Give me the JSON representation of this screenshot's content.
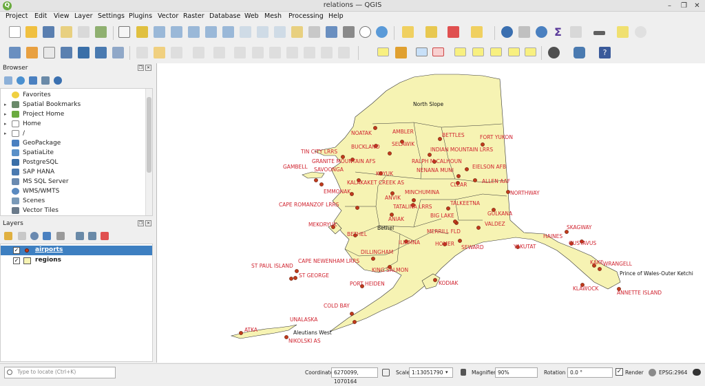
{
  "window": {
    "title": "relations — QGIS"
  },
  "menu": [
    "Project",
    "Edit",
    "View",
    "Layer",
    "Settings",
    "Plugins",
    "Vector",
    "Raster",
    "Database",
    "Web",
    "Mesh",
    "Processing",
    "Help"
  ],
  "browser": {
    "title": "Browser",
    "items": [
      "Favorites",
      "Spatial Bookmarks",
      "Project Home",
      "Home",
      "/",
      "GeoPackage",
      "SpatiaLite",
      "PostgreSQL",
      "SAP HANA",
      "MS SQL Server",
      "WMS/WMTS",
      "Scenes",
      "Vector Tiles"
    ]
  },
  "layers": {
    "title": "Layers",
    "items": [
      {
        "name": "airports",
        "checked": true,
        "selected": true
      },
      {
        "name": "regions",
        "checked": true,
        "selected": false
      }
    ]
  },
  "map": {
    "region_labels": [
      "North Slope",
      "Bethel",
      "Aleutians West",
      "Prince of Wales-Outer Ketchi"
    ],
    "airport_labels": [
      "NOATAK",
      "AMBLER",
      "BETTLES",
      "FORT YUKON",
      "BUCKLAND",
      "SELAWIK",
      "TIN CITY LRRS",
      "INDIAN MOUNTAIN LRRS",
      "GRANITE MOUNTAIN AFS",
      "RALPH M CALHOUN",
      "GAMBELL",
      "SAVOONGA",
      "NENANA MUNI",
      "EIELSON AFB",
      "KOYUK",
      "KALAKAKET CREEK AS",
      "CLEAR",
      "ALLEN AAF",
      "EMMONAK",
      "MINCHUMINA",
      "NORTHWAY",
      "ANVIK",
      "CAPE ROMANZOF LRRS",
      "TATALINA LRRS",
      "TALKEETNA",
      "GULKANA",
      "ANIAK",
      "BIG LAKE",
      "VALDEZ",
      "MEKORYUK",
      "SKAGWAY",
      "BETHEL",
      "MERRILL FLD",
      "HAINES",
      "ILIAMNA",
      "HOMER",
      "SEWARD",
      "GUSTAVUS",
      "YAKUTAT",
      "DILLINGHAM",
      "CAPE NEWENHAM LRRS",
      "KAKE",
      "WRANGELL",
      "ST PAUL ISLAND",
      "KING SALMON",
      "ST GEORGE",
      "KODIAK",
      "PORT HEIDEN",
      "KLAWOCK",
      "ANNETTE ISLAND",
      "COLD BAY",
      "UNALASKA",
      "ATKA",
      "NIKOLSKI AS"
    ]
  },
  "status": {
    "search_placeholder": "Type to locate (Ctrl+K)",
    "coordinate_label": "Coordinate",
    "coordinate_value": "6270099, 1070164",
    "scale_label": "Scale",
    "scale_value": "1:13051790",
    "magnifier_label": "Magnifier",
    "magnifier_value": "90%",
    "rotation_label": "Rotation",
    "rotation_value": "0.0 °",
    "render_label": "Render",
    "crs": "EPSG:2964"
  },
  "colors": {
    "region_fill": "#f6f3b3",
    "airport": "#c03a1c",
    "label": "#d0232f",
    "selection": "#3d7fc1"
  }
}
